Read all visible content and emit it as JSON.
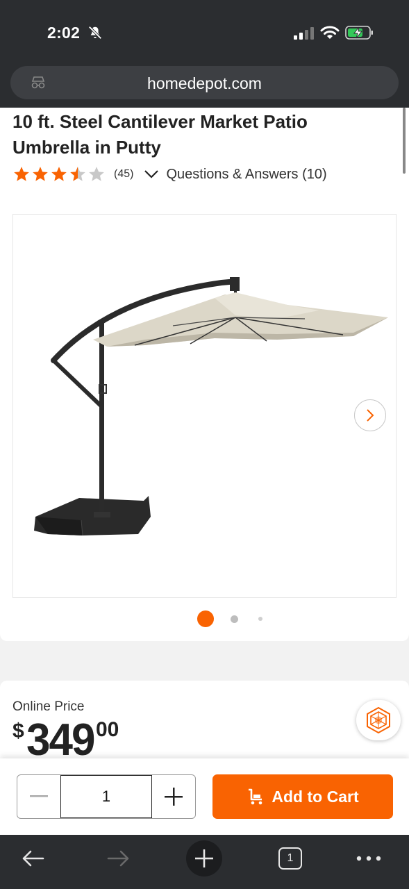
{
  "status_bar": {
    "time": "2:02"
  },
  "browser": {
    "url": "homedepot.com",
    "tab_count": "1"
  },
  "product": {
    "title": "10 ft. Steel Cantilever Market Patio Umbrella in Putty",
    "rating": 3.5,
    "rating_max": 5,
    "review_count": "(45)",
    "qa_label": "Questions & Answers (10)",
    "image_count": 3,
    "current_image": 1
  },
  "price": {
    "label": "Online Price",
    "dollar_sign": "$",
    "whole": "349",
    "cents": "00"
  },
  "cart": {
    "quantity": "1",
    "add_to_cart_label": "Add to Cart"
  },
  "colors": {
    "brand_orange": "#f96302",
    "star_orange": "#f96302",
    "star_empty": "#c8c8c8",
    "dark_chrome": "#2b2d30"
  }
}
